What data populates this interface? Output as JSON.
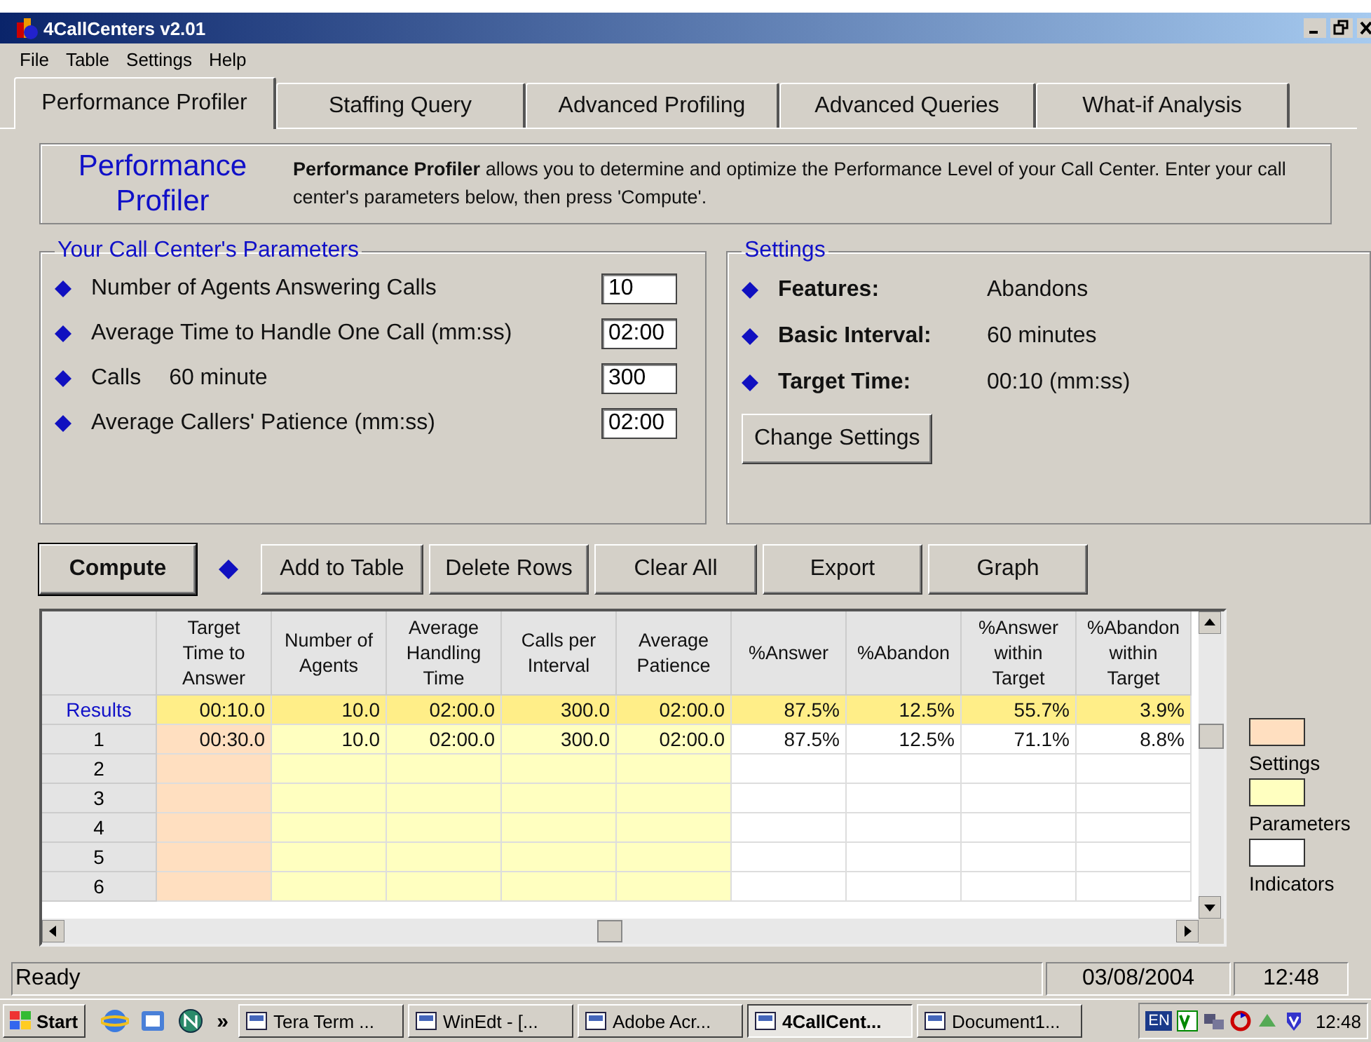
{
  "window": {
    "title": "4CallCenters v2.01"
  },
  "menu": [
    "File",
    "Table",
    "Settings",
    "Help"
  ],
  "tabs": [
    {
      "label": "Performance Profiler",
      "selected": true
    },
    {
      "label": "Staffing Query",
      "selected": false
    },
    {
      "label": "Advanced Profiling",
      "selected": false
    },
    {
      "label": "Advanced Queries",
      "selected": false
    },
    {
      "label": "What-if Analysis",
      "selected": false
    }
  ],
  "intro": {
    "heading": "Performance Profiler",
    "text": "**Performance Profiler** allows you to determine and optimize the Performance Level of your Call Center. Enter your call center's parameters below, then press 'Compute'."
  },
  "parameters": {
    "title": "Your Call Center's Parameters",
    "items": [
      {
        "label": "Number of Agents Answering Calls",
        "value": "10"
      },
      {
        "label": "Average Time to Handle One Call (mm:ss)",
        "value": "02:00"
      },
      {
        "label": "Calls",
        "unit": "60 minute",
        "value": "300"
      },
      {
        "label": "Average Callers' Patience (mm:ss)",
        "value": "02:00"
      }
    ]
  },
  "settings": {
    "title": "Settings",
    "items": [
      {
        "label": "Features:",
        "value": "Abandons"
      },
      {
        "label": "Basic Interval:",
        "value": "60 minutes"
      },
      {
        "label": "Target Time:",
        "value": "00:10 (mm:ss)"
      }
    ],
    "button": "Change Settings"
  },
  "actions": [
    {
      "label": "Compute",
      "kind": "default"
    },
    {
      "label": "Add to Table",
      "kind": "normal"
    },
    {
      "label": "Delete Rows",
      "kind": "normal"
    },
    {
      "label": "Clear All",
      "kind": "normal"
    },
    {
      "label": "Export",
      "kind": "normal"
    },
    {
      "label": "Graph",
      "kind": "normal"
    }
  ],
  "table": {
    "columns": [
      {
        "label": "Target Time to Answer",
        "kind": "settings"
      },
      {
        "label": "Number of Agents",
        "kind": "parameters"
      },
      {
        "label": "Average Handling Time",
        "kind": "parameters"
      },
      {
        "label": "Calls per Interval",
        "kind": "parameters"
      },
      {
        "label": "Average Patience",
        "kind": "parameters"
      },
      {
        "label": "%Answer",
        "kind": "indicators"
      },
      {
        "label": "%Abandon",
        "kind": "indicators"
      },
      {
        "label": "%Answer within Target",
        "kind": "indicators"
      },
      {
        "label": "%Abandon within Target",
        "kind": "indicators"
      }
    ],
    "rows": [
      {
        "header": "Results",
        "kind": "results",
        "cells": [
          "00:10.0",
          "10.0",
          "02:00.0",
          "300.0",
          "02:00.0",
          "87.5%",
          "12.5%",
          "55.7%",
          "3.9%"
        ]
      },
      {
        "header": "1",
        "kind": "data",
        "cells": [
          "00:30.0",
          "10.0",
          "02:00.0",
          "300.0",
          "02:00.0",
          "87.5%",
          "12.5%",
          "71.1%",
          "8.8%"
        ]
      },
      {
        "header": "2",
        "kind": "data",
        "cells": []
      },
      {
        "header": "3",
        "kind": "data",
        "cells": []
      },
      {
        "header": "4",
        "kind": "data",
        "cells": []
      },
      {
        "header": "5",
        "kind": "data",
        "cells": []
      },
      {
        "header": "6",
        "kind": "data",
        "cells": []
      }
    ]
  },
  "legend": [
    {
      "label": "Settings",
      "color": "#ffdfc0"
    },
    {
      "label": "Parameters",
      "color": "#ffffc0"
    },
    {
      "label": "Indicators",
      "color": "#ffffff"
    }
  ],
  "status_bar": {
    "text": "Ready",
    "date": "03/08/2004",
    "time": "12:48"
  },
  "taskbar": {
    "start": "Start",
    "chevron": "»",
    "tasks": [
      {
        "label": "Tera Term ...",
        "selected": false
      },
      {
        "label": "WinEdt  - [...",
        "selected": false
      },
      {
        "label": "Adobe Acr...",
        "selected": false
      },
      {
        "label": "4CallCent...",
        "selected": true
      },
      {
        "label": "Document1...",
        "selected": false
      }
    ],
    "lang": "EN",
    "clock": "12:48"
  }
}
